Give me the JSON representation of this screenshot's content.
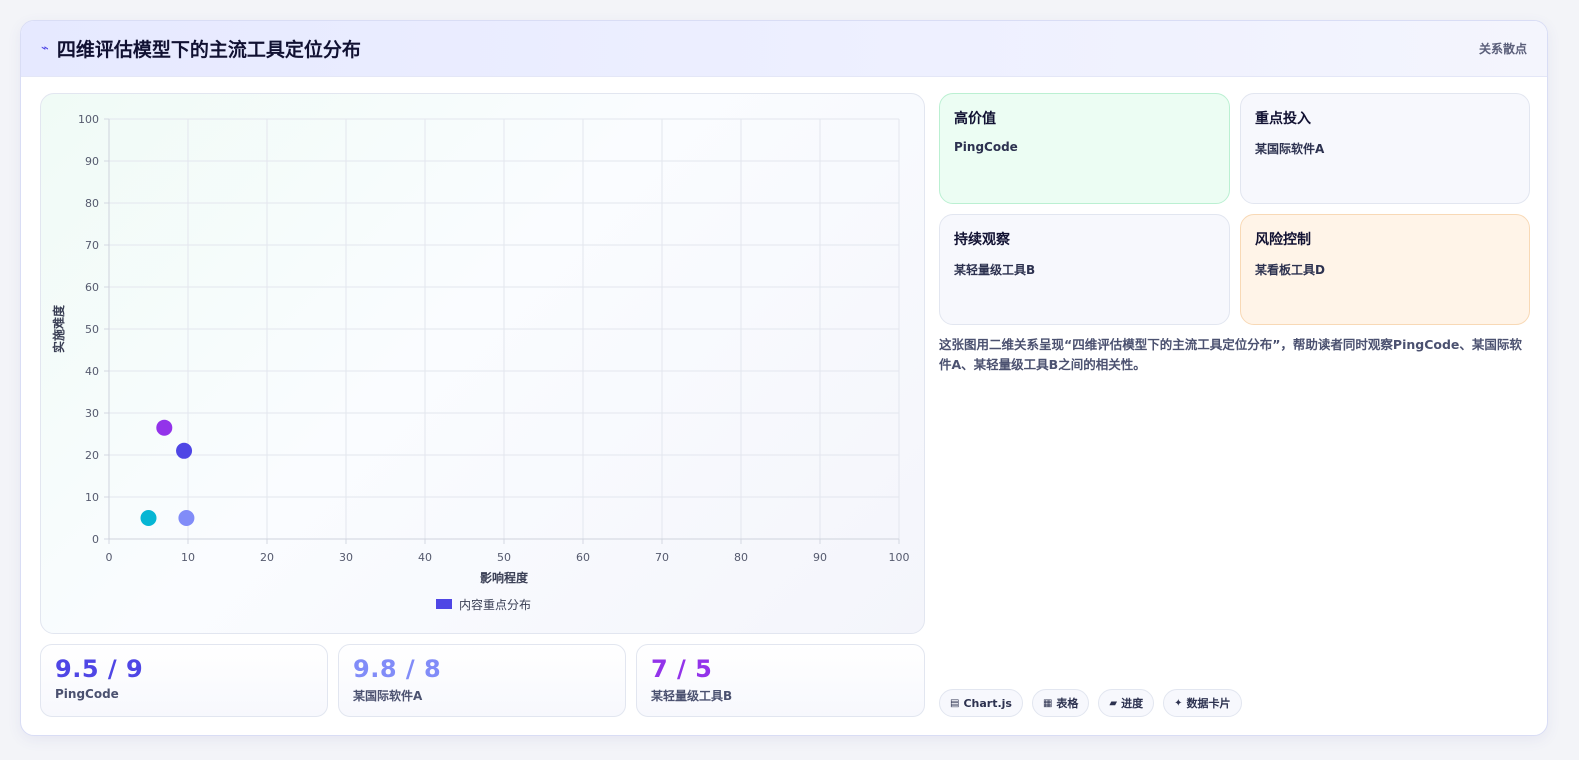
{
  "header": {
    "title": "四维评估模型下的主流工具定位分布",
    "tag": "关系散点"
  },
  "chart_data": {
    "type": "scatter",
    "xlabel": "影响程度",
    "ylabel": "实施难度",
    "xlim": [
      0,
      100
    ],
    "ylim": [
      0,
      100
    ],
    "x_ticks": [
      "0",
      "10",
      "20",
      "30",
      "40",
      "50",
      "60",
      "70",
      "80",
      "90",
      "100"
    ],
    "y_ticks": [
      "0",
      "10",
      "20",
      "30",
      "40",
      "50",
      "60",
      "70",
      "80",
      "90",
      "100"
    ],
    "grid": true,
    "legend": {
      "position": "bottom",
      "entries": [
        "内容重点分布"
      ]
    },
    "series": [
      {
        "name": "内容重点分布",
        "points": [
          {
            "x": 9.5,
            "y": 21,
            "color": "#4f46e5"
          },
          {
            "x": 9.8,
            "y": 5,
            "color": "#818cf8"
          },
          {
            "x": 7,
            "y": 26.5,
            "color": "#9333ea"
          },
          {
            "x": 5,
            "y": 5,
            "color": "#06b6d4"
          }
        ]
      }
    ],
    "legend_color": "#4f46e5"
  },
  "stats": [
    {
      "value": "9.5 / 9",
      "label": "PingCode",
      "color": "#4f46e5"
    },
    {
      "value": "9.8 / 8",
      "label": "某国际软件A",
      "color": "#818cf8"
    },
    {
      "value": "7 / 5",
      "label": "某轻量级工具B",
      "color": "#9333ea"
    }
  ],
  "quadrants": [
    {
      "title": "高价值",
      "item": "PingCode",
      "bg": "#ecfdf3",
      "border": "#bbf0d2"
    },
    {
      "title": "重点投入",
      "item": "某国际软件A",
      "bg": "#f7f8fd",
      "border": "#e2e6f0"
    },
    {
      "title": "持续观察",
      "item": "某轻量级工具B",
      "bg": "#f7f8fd",
      "border": "#e2e6f0"
    },
    {
      "title": "风险控制",
      "item": "某看板工具D",
      "bg": "#fff4e8",
      "border": "#f8d9b6"
    }
  ],
  "description": "这张图用二维关系呈现“四维评估模型下的主流工具定位分布”，帮助读者同时观察PingCode、某国际软件A、某轻量级工具B之间的相关性。",
  "chips": [
    {
      "icon": "chart-icon",
      "glyph": "▤",
      "label": "Chart.js"
    },
    {
      "icon": "table-icon",
      "glyph": "▦",
      "label": "表格"
    },
    {
      "icon": "progress-icon",
      "glyph": "▰",
      "label": "进度"
    },
    {
      "icon": "sparkle-icon",
      "glyph": "✦",
      "label": "数据卡片"
    }
  ]
}
